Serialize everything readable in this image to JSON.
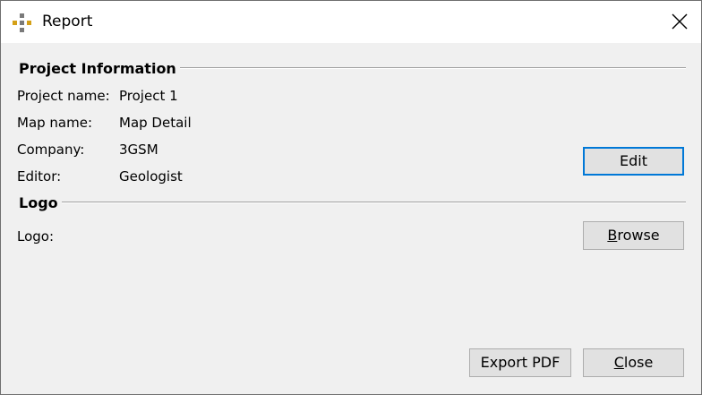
{
  "window": {
    "title": "Report",
    "icon": "app-logo-icon",
    "close_icon": "close-icon"
  },
  "project_section": {
    "title": "Project Information",
    "fields": [
      {
        "label": "Project name:",
        "value": "Project 1"
      },
      {
        "label": "Map name:",
        "value": "Map Detail"
      },
      {
        "label": "Company:",
        "value": "3GSM"
      },
      {
        "label": "Editor:",
        "value": "Geologist"
      }
    ],
    "edit_label": "Edit"
  },
  "logo_section": {
    "title": "Logo",
    "logo_label": "Logo:",
    "browse_label_first": "B",
    "browse_label_rest": "rowse"
  },
  "footer": {
    "export_label": "Export PDF",
    "close_label_first": "C",
    "close_label_rest": "lose"
  },
  "colors": {
    "accent": "#0078d7",
    "icon_gold": "#d4a017",
    "icon_gray": "#7a7a7a"
  }
}
